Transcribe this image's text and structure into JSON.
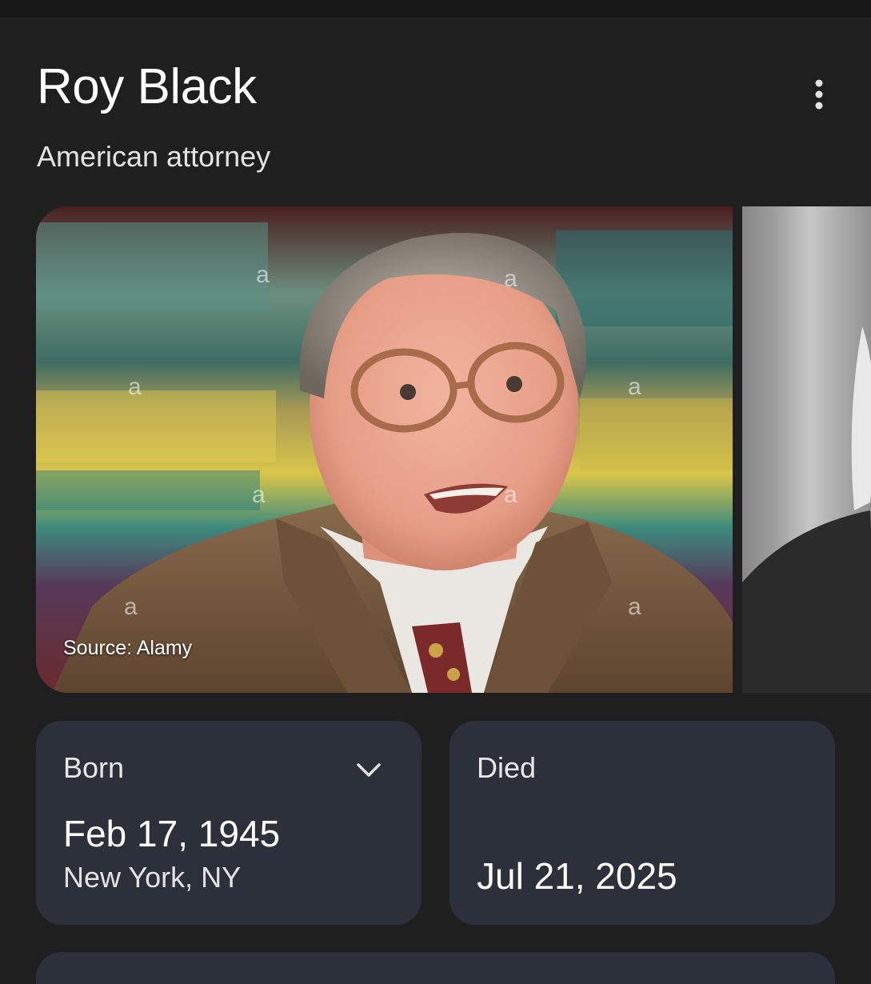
{
  "header": {
    "title": "Roy Black",
    "subtitle": "American attorney"
  },
  "icons": {
    "more": "more-vert-icon",
    "expand": "chevron-down-icon"
  },
  "gallery": {
    "source_label": "Source: Alamy",
    "watermark_glyph": "a"
  },
  "facts": {
    "born": {
      "label": "Born",
      "date": "Feb 17, 1945",
      "place": "New York, NY"
    },
    "died": {
      "label": "Died",
      "date": "Jul 21, 2025"
    }
  },
  "colors": {
    "background": "#1f1f1f",
    "card": "#2c303a",
    "text": "#e3e3e3"
  }
}
